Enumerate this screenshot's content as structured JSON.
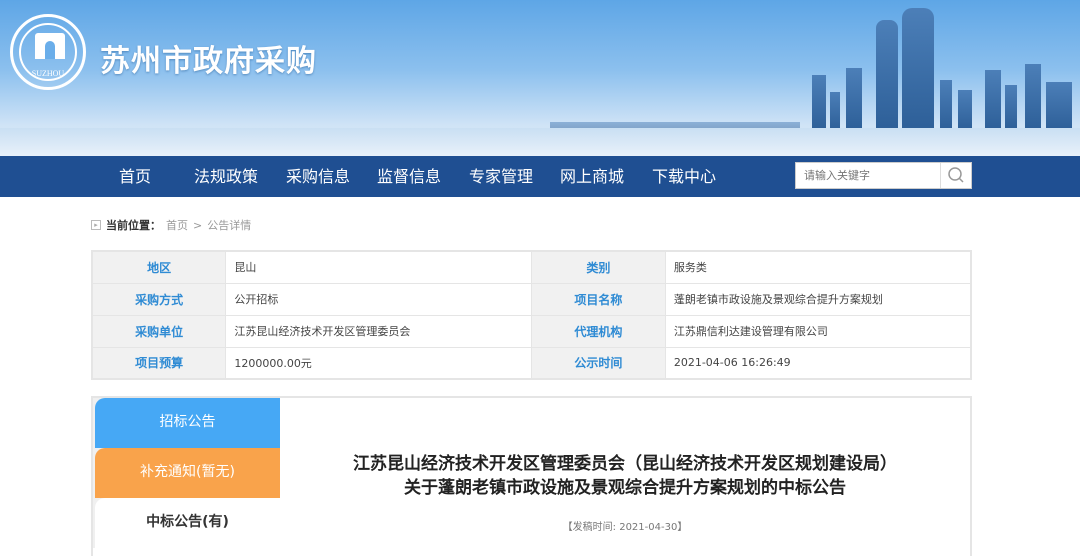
{
  "header": {
    "site_title": "苏州市政府采购",
    "logo_text": "SUZHOU"
  },
  "nav": {
    "items": [
      "首页",
      "法规政策",
      "采购信息",
      "监督信息",
      "专家管理",
      "网上商城",
      "下载中心"
    ],
    "search_placeholder": "请输入关键字"
  },
  "breadcrumb": {
    "label": "当前位置：",
    "items": [
      "首页",
      "公告详情"
    ],
    "separator": ">"
  },
  "info": {
    "rows": [
      [
        {
          "label": "地区",
          "value": "昆山"
        },
        {
          "label": "类别",
          "value": "服务类"
        }
      ],
      [
        {
          "label": "采购方式",
          "value": "公开招标"
        },
        {
          "label": "项目名称",
          "value": "蓬朗老镇市政设施及景观综合提升方案规划"
        }
      ],
      [
        {
          "label": "采购单位",
          "value": "江苏昆山经济技术开发区管理委员会"
        },
        {
          "label": "代理机构",
          "value": "江苏鼎信利达建设管理有限公司"
        }
      ],
      [
        {
          "label": "项目预算",
          "value": "1200000.00元"
        },
        {
          "label": "公示时间",
          "value": "2021-04-06 16:26:49"
        }
      ]
    ]
  },
  "tabs": [
    {
      "label": "招标公告",
      "color": "#46a8f5"
    },
    {
      "label": "补充通知(暂无)",
      "color": "#f9a34b"
    },
    {
      "label": "中标公告(有)",
      "color": "#ffffff"
    }
  ],
  "announcement": {
    "title_line1": "江苏昆山经济技术开发区管理委员会（昆山经济技术开发区规划建设局）",
    "title_line2": "关于蓬朗老镇市政设施及景观综合提升方案规划的中标公告",
    "date": "【发稿时间: 2021-04-30】"
  }
}
